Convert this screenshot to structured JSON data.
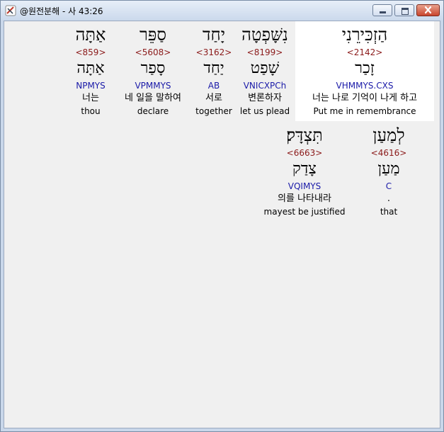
{
  "window": {
    "title": "@원전분해 - 사 43:26"
  },
  "rows": [
    {
      "words": [
        {
          "heb": "אַתָּה",
          "strong": "<859>",
          "lemma": "אַתָּה",
          "morph": "NPMYS",
          "kor": "너는",
          "eng": "thou"
        },
        {
          "heb": "סַפֵּר",
          "strong": "<5608>",
          "lemma": "סָפַר",
          "morph": "VPMMYS",
          "kor": "네 일을 말하여",
          "eng": "declare"
        },
        {
          "heb": "יָחַד",
          "strong": "<3162>",
          "lemma": "יַחַד",
          "morph": "AB",
          "kor": "서로",
          "eng": "together"
        },
        {
          "heb": "נִשָּׁפְטָה",
          "strong": "<8199>",
          "lemma": "שָׁפַט",
          "morph": "VNICXPCh",
          "kor": "변론하자",
          "eng": "let us plead"
        },
        {
          "heb": "הַזְכִּירֵנִי",
          "strong": "<2142>",
          "lemma": "זָכַר",
          "morph": "VHMMYS.CXS",
          "kor": "너는 나로 기억이 나게 하고",
          "eng": "Put me in remembrance"
        }
      ]
    },
    {
      "words": [
        {
          "heb": "תִּצְדָּק׃",
          "strong": "<6663>",
          "lemma": "צָדַק",
          "morph": "VQIMYS",
          "kor": "의를 나타내라",
          "eng": "mayest be justified"
        },
        {
          "heb": "לְמַעַן",
          "strong": "<4616>",
          "lemma": "מַעַן",
          "morph": "C",
          "kor": ".",
          "eng": "that"
        }
      ]
    }
  ]
}
